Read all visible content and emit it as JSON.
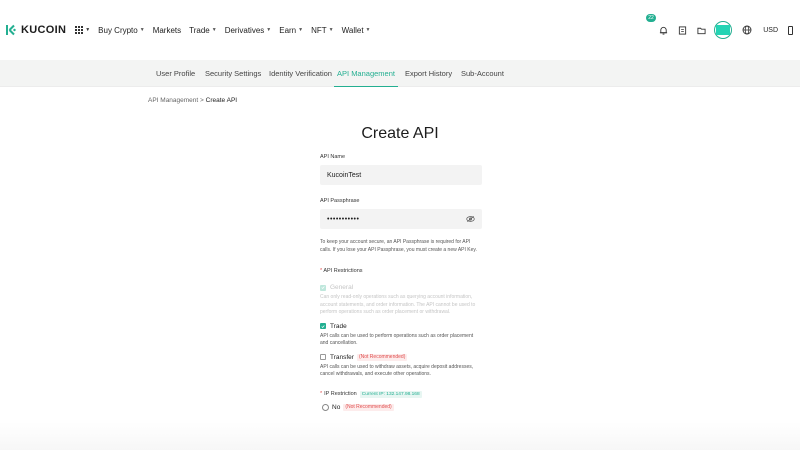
{
  "brand": {
    "name": "KUCOIN",
    "color": "#23af91"
  },
  "topnav": {
    "links": [
      {
        "label": "Buy Crypto",
        "has_caret": true
      },
      {
        "label": "Markets",
        "has_caret": false
      },
      {
        "label": "Trade",
        "has_caret": true
      },
      {
        "label": "Derivatives",
        "has_caret": true
      },
      {
        "label": "Earn",
        "has_caret": true
      },
      {
        "label": "NFT",
        "has_caret": true
      },
      {
        "label": "Wallet",
        "has_caret": true
      }
    ],
    "notification_count": "22",
    "currency": "USD",
    "icons": [
      "apps-grid-icon",
      "bell-icon",
      "orders-icon",
      "wallet-icon",
      "avatar",
      "globe-icon",
      "phone-icon"
    ]
  },
  "subnav": {
    "tabs": [
      {
        "label": "User Profile",
        "active": false
      },
      {
        "label": "Security Settings",
        "active": false
      },
      {
        "label": "Identity Verification",
        "active": false
      },
      {
        "label": "API Management",
        "active": true
      },
      {
        "label": "Export History",
        "active": false
      },
      {
        "label": "Sub-Account",
        "active": false
      }
    ]
  },
  "breadcrumb": {
    "parent": "API Management",
    "separator": ">",
    "current": "Create API"
  },
  "page_title": "Create API",
  "form": {
    "api_name": {
      "label": "API Name",
      "value": "KucoinTest"
    },
    "api_passphrase": {
      "label": "API Passphrase",
      "value": "•••••••••••",
      "hint": "To keep your account secure, an API Passphrase is required for API calls. If you lose your API Passphrase, you must create a new API Key."
    },
    "restrictions": {
      "required_mark": "*",
      "label": "API Restrictions",
      "options": [
        {
          "label": "General",
          "checked": true,
          "disabled": true,
          "description": "Can only read-only operations such as querying account information, account statements, and order information. The API cannot be used to perform operations such as order placement or withdrawal."
        },
        {
          "label": "Trade",
          "checked": true,
          "disabled": false,
          "description": "API calls can be used to perform operations such as order placement and cancellation."
        },
        {
          "label": "Transfer",
          "checked": false,
          "disabled": false,
          "tag": "(Not Recommended)",
          "description": "API calls can be used to withdraw assets, acquire deposit addresses, cancel withdrawals, and execute other operations."
        }
      ]
    },
    "ip_restriction": {
      "required_mark": "*",
      "label": "IP Restriction",
      "current_ip": "Current IP: 132.147.98.168",
      "options": [
        {
          "label": "No",
          "tag": "(Not Recommended)",
          "selected": false
        }
      ]
    }
  }
}
